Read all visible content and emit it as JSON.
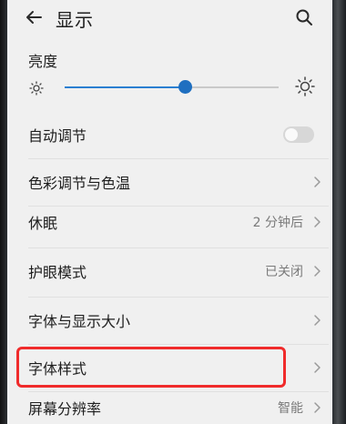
{
  "header": {
    "back_icon": "arrow-left-icon",
    "title": "显示",
    "search_icon": "search-icon"
  },
  "brightness": {
    "label": "亮度",
    "level_fraction": 0.56,
    "low_icon": "sun-small-icon",
    "high_icon": "sun-large-icon"
  },
  "rows": {
    "auto_adjust": {
      "label": "自动调节",
      "toggle_on": false
    },
    "color_temp": {
      "label": "色彩调节与色温"
    },
    "sleep": {
      "label": "休眠",
      "value": "2 分钟后"
    },
    "eye_care": {
      "label": "护眼模式",
      "value": "已关闭"
    },
    "font_display_size": {
      "label": "字体与显示大小"
    },
    "font_style": {
      "label": "字体样式"
    },
    "resolution": {
      "label": "屏幕分辨率",
      "value": "智能"
    }
  },
  "colors": {
    "accent": "#1f6fc0",
    "highlight_box": "#f02b2b",
    "background": "#f0f0f0"
  }
}
